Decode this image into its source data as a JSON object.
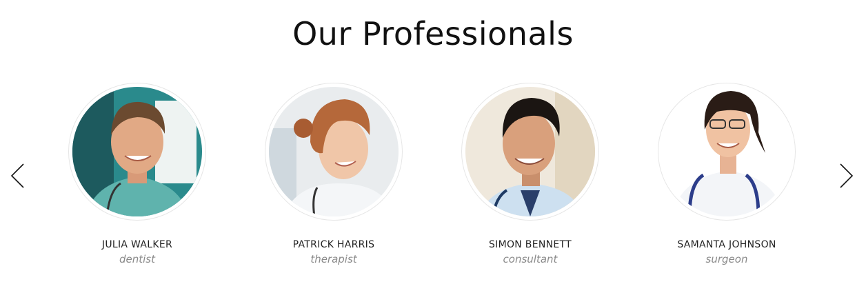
{
  "section": {
    "title": "Our Professionals"
  },
  "carousel": {
    "prev_icon": "chevron-left-icon",
    "next_icon": "chevron-right-icon",
    "members": [
      {
        "name": "JULIA WALKER",
        "role": "dentist",
        "photo": "doctor-portrait-teal-scrubs"
      },
      {
        "name": "PATRICK HARRIS",
        "role": "therapist",
        "photo": "doctor-portrait-white-coat"
      },
      {
        "name": "SIMON BENNETT",
        "role": "consultant",
        "photo": "doctor-portrait-blue-shirt"
      },
      {
        "name": "SAMANTA JOHNSON",
        "role": "surgeon",
        "photo": "doctor-portrait-glasses"
      }
    ]
  },
  "colors": {
    "title": "#111111",
    "name": "#222222",
    "role": "#8a8a8a",
    "ring": "#e6e6e6"
  }
}
